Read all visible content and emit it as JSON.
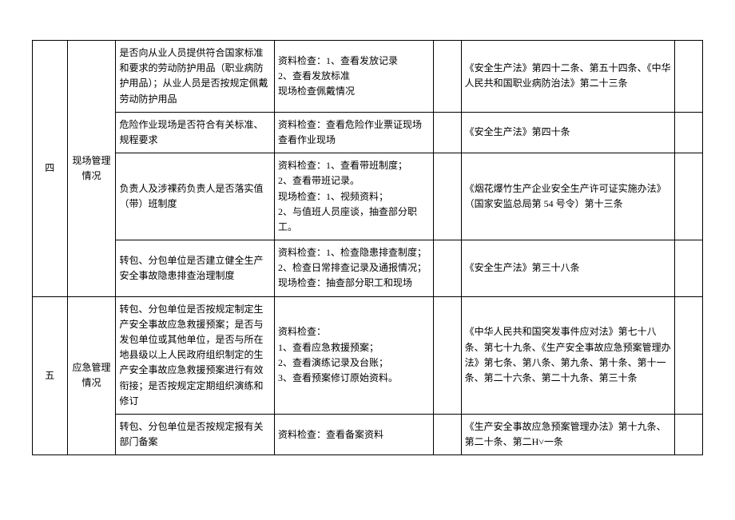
{
  "sections": [
    {
      "index": "四",
      "category": "现场管理情况",
      "rows": [
        {
          "item": "是否向从业人员提供符合国家标准和要求的劳动防护用品（职业病防护用品）；从业人员是否按规定佩戴劳动防护用品",
          "method": "资料检查：1、查看发放记录\n2、查看发放标准\n现场检查佩戴情况",
          "basis": "《安全生产法》第四十二条、第五十四条、《中华人民共和国职业病防治法》第二十三条"
        },
        {
          "item": "危险作业现场是否符合有关标准、规程要求",
          "method": "资料检查：查看危险作业票证现场查看作业现场",
          "basis": "《安全生产法》第四十条"
        },
        {
          "item": "负责人及涉裸药负责人是否落实值（带）班制度",
          "method": "资料检查：1、查看带班制度；\n2、查看带班记录。\n现场检查：1、视频资料；\n2、与值班人员座谈，抽查部分职工。",
          "basis": "《烟花爆竹生产企业安全生产许可证实施办法》（国家安监总局第 54 号令）第十三条"
        },
        {
          "item": "转包、分包单位是否建立健全生产安全事故隐患排查治理制度",
          "method": "资料检查：1、检查隐患排查制度；2、检查日常排查记录及通报情况；现场检查：抽查部分职工和现场",
          "basis": "《安全生产法》第三十八条"
        }
      ]
    },
    {
      "index": "五",
      "category": "应急管理情况",
      "rows": [
        {
          "item": "转包、分包单位是否按规定制定生产安全事故应急救援预案；是否与发包单位或其他单位，是否与所在地县级以上人民政府组织制定的生产安全事故应急救援预案进行有效衔接；是否按规定定期组织演练和修订",
          "method": "资料检查：\n1、查看应急救援预案；\n2、查看演练记录及台账；\n3、查看预案修订原始资料。",
          "basis": "《中华人民共和国突发事件应对法》第七十八条、第七十九条、《生产安全事故应急预案管理办法》第七条、第八条、第九条、第十条、第十一条、第二十六条、第二十九条、第三十条"
        },
        {
          "item": "转包、分包单位是否按规定报有关部门备案",
          "method": "资料检查：查看备案资料",
          "basis": "《生产安全事故应急预案管理办法》第十九条、第二十条、第二H˅一条"
        }
      ]
    }
  ]
}
